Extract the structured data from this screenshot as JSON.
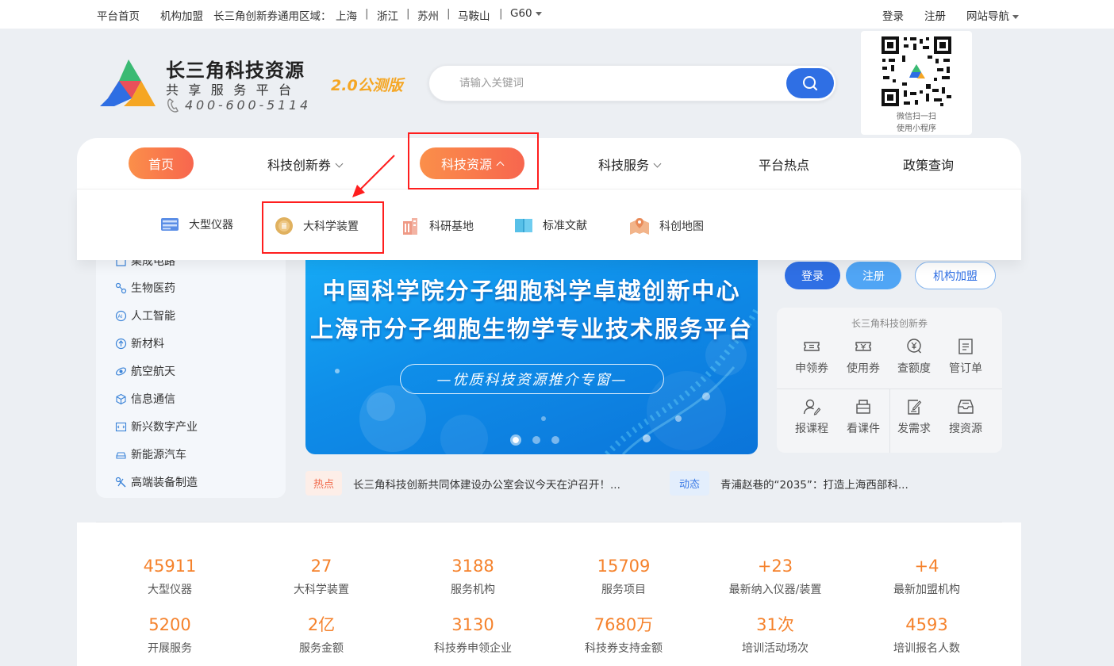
{
  "topbar": {
    "home": "平台首页",
    "join": "机构加盟",
    "region_label": "长三角创新券通用区域：",
    "regions": [
      "上海",
      "浙江",
      "苏州",
      "马鞍山",
      "G60"
    ],
    "separator": "|",
    "login": "登录",
    "register": "注册",
    "site_nav": "网站导航"
  },
  "brand": {
    "title": "长三角科技资源",
    "subtitle": "共享服务平台",
    "phone": "400-600-5114",
    "beta": "2.0公测版"
  },
  "search": {
    "placeholder": "请输入关键词",
    "value": ""
  },
  "qr": {
    "line1": "微信扫一扫",
    "line2": "使用小程序"
  },
  "nav": {
    "items": [
      "首页",
      "科技创新券",
      "科技资源",
      "科技服务",
      "平台热点",
      "政策查询"
    ]
  },
  "dropdown": {
    "items": [
      "大型仪器",
      "大科学装置",
      "科研基地",
      "标准文献",
      "科创地图"
    ]
  },
  "sidebar": {
    "items": [
      "集成电路",
      "生物医药",
      "人工智能",
      "新材料",
      "航空航天",
      "信息通信",
      "新兴数字产业",
      "新能源汽车",
      "高端装备制造"
    ]
  },
  "banner": {
    "line1": "中国科学院分子细胞科学卓越创新中心",
    "line2": "上海市分子细胞生物学专业技术服务平台",
    "pill": "—优质科技资源推介专窗—",
    "slide_count": 3,
    "active_slide": 1
  },
  "news": {
    "hot_tag": "热点",
    "hot_text": "长三角科技创新共同体建设办公室会议今天在沪召开！...",
    "dyn_tag": "动态",
    "dyn_text": "青浦赵巷的“2035”：打造上海西部科..."
  },
  "account": {
    "login": "登录",
    "register": "注册",
    "join": "机构加盟"
  },
  "voucher_panel": {
    "title": "长三角科技创新券",
    "row1": [
      "申领券",
      "使用券",
      "查额度",
      "管订单"
    ],
    "row2": [
      "报课程",
      "看课件",
      "发需求",
      "搜资源"
    ]
  },
  "stats": {
    "row1": [
      {
        "value": "45911",
        "label": "大型仪器"
      },
      {
        "value": "27",
        "label": "大科学装置"
      },
      {
        "value": "3188",
        "label": "服务机构"
      },
      {
        "value": "15709",
        "label": "服务项目"
      },
      {
        "value": "+23",
        "label": "最新纳入仪器/装置"
      },
      {
        "value": "+4",
        "label": "最新加盟机构"
      }
    ],
    "row2": [
      {
        "value": "5200",
        "label": "开展服务"
      },
      {
        "value": "2亿",
        "label": "服务金额"
      },
      {
        "value": "3130",
        "label": "科技券申领企业"
      },
      {
        "value": "7680万",
        "label": "科技券支持金额"
      },
      {
        "value": "31次",
        "label": "培训活动场次"
      },
      {
        "value": "4593",
        "label": "培训报名人数"
      }
    ]
  },
  "colors": {
    "accent_orange": "#f5822c",
    "primary_blue": "#2f6fe4",
    "highlight_red": "#ff1e1e"
  }
}
